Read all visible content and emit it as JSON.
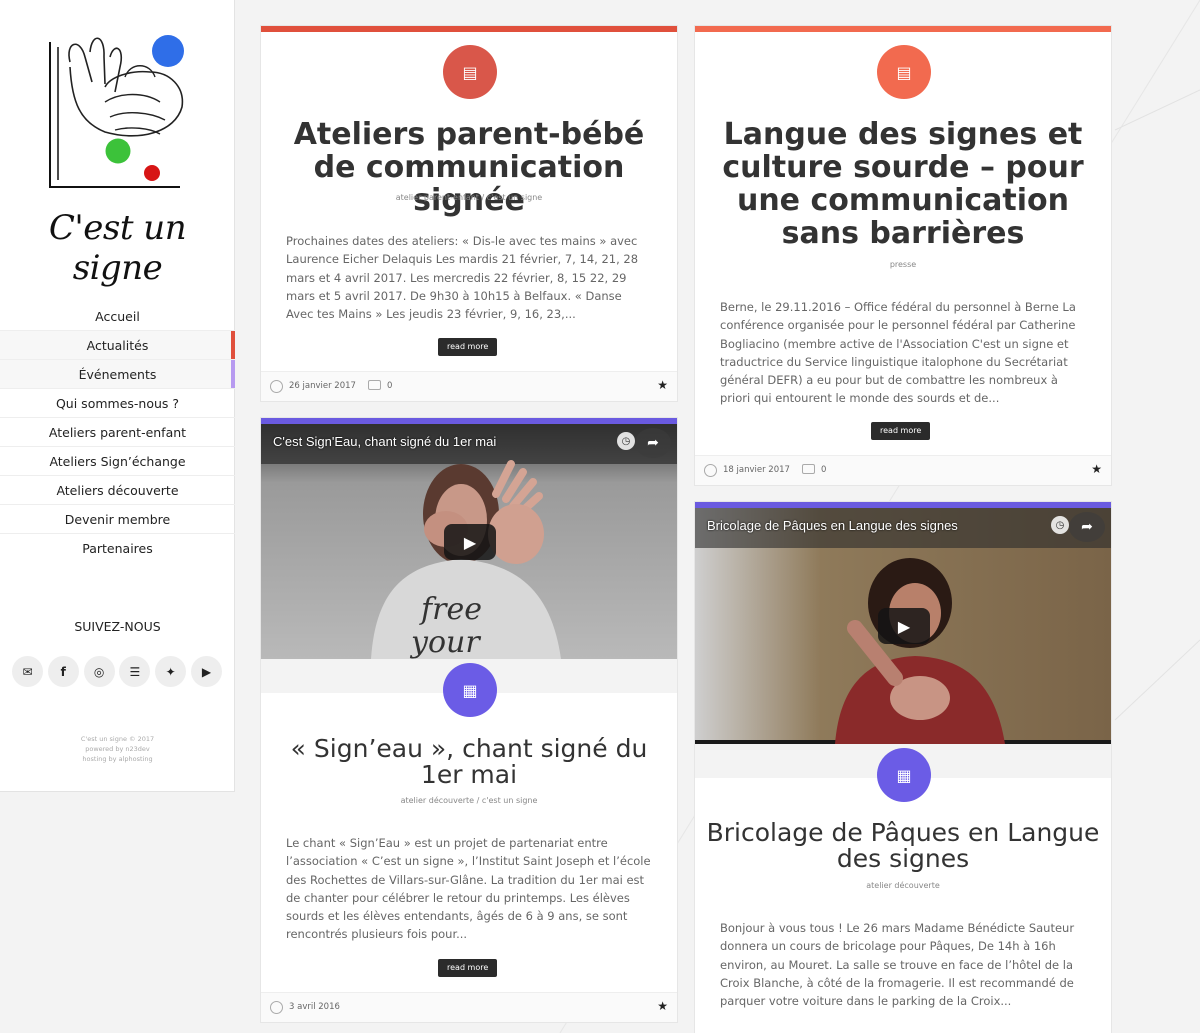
{
  "colors": {
    "red": "#e0503c",
    "red_badge": "#d9574a",
    "orange_badge": "#f26a4f",
    "purple": "#6a5ae0",
    "purple_badge": "#6b5ce6"
  },
  "brand": {
    "name": "C'est un signe"
  },
  "nav": {
    "items": [
      "Accueil",
      "Actualités",
      "Événements",
      "Qui sommes-nous ?",
      "Ateliers parent-enfant",
      "Ateliers Sign’échange",
      "Ateliers découverte",
      "Devenir membre",
      "Partenaires"
    ]
  },
  "follow": {
    "label": "SUIVEZ-NOUS",
    "icons": [
      "mail-icon",
      "facebook-icon",
      "instagram-icon",
      "rss-icon",
      "twitter-icon",
      "youtube-icon"
    ]
  },
  "credits": {
    "line1": "C'est un signe © 2017",
    "line2": "powered by n23dev",
    "line3": "hosting by alphosting"
  },
  "posts": [
    {
      "icon": "document-icon",
      "title": "Ateliers parent-bébé de communication signée",
      "meta": "atelier parent-enfant / c'est un signe",
      "excerpt": "Prochaines dates des ateliers: « Dis-le avec tes mains » avec Laurence Eicher Delaquis Les mardis 21 février, 7, 14, 21, 28 mars et 4 avril 2017. Les mercredis 22 février, 8, 15 22, 29 mars et 5 avril 2017. De 9h30 à 10h15 à Belfaux. « Danse Avec tes Mains » Les jeudis 23 février, 9, 16, 23,...",
      "readmore": "read more",
      "date": "26 janvier 2017",
      "comments": "0"
    },
    {
      "icon": "document-icon",
      "title": "Langue des signes et culture sourde – pour une communication sans barrières",
      "meta": "presse",
      "excerpt": "Berne, le 29.11.2016 – Office fédéral du personnel à Berne La conférence organisée pour le personnel fédéral par Catherine Bogliacino (membre active de l'Association C'est un signe et traductrice du Service linguistique italophone du Secrétariat général DEFR) a eu pour but de combattre les nombreux à priori qui entourent le monde des sourds et de...",
      "readmore": "read more",
      "date": "18 janvier 2017",
      "comments": "0"
    },
    {
      "icon": "film-icon",
      "video_title": "C'est Sign'Eau, chant signé du 1er mai",
      "title": "« Sign’eau », chant signé du 1er mai",
      "meta": "atelier découverte / c'est un signe",
      "excerpt": "Le chant « Sign’Eau » est un projet de partenariat entre l’association « C’est un signe », l’Institut Saint Joseph et l’école des Rochettes de Villars-sur-Glâne. La tradition du 1er mai est de chanter pour célébrer le retour du printemps. Les élèves sourds et les élèves entendants, âgés de 6 à 9 ans, se sont rencontrés plusieurs fois pour...",
      "readmore": "read more",
      "date": "3 avril 2016"
    },
    {
      "icon": "film-icon",
      "video_title": "Bricolage de Pâques en Langue des signes",
      "title": "Bricolage de Pâques en Langue des signes",
      "meta": "atelier découverte",
      "excerpt": "Bonjour à vous tous ! Le 26 mars Madame Bénédicte Sauteur donnera un cours de bricolage pour Pâques, De 14h à 16h environ, au Mouret. La salle se trouve en face de l’hôtel de la Croix Blanche, à côté de la fromagerie. Il est recommandé de parquer votre voiture dans le parking de la Croix..."
    }
  ]
}
